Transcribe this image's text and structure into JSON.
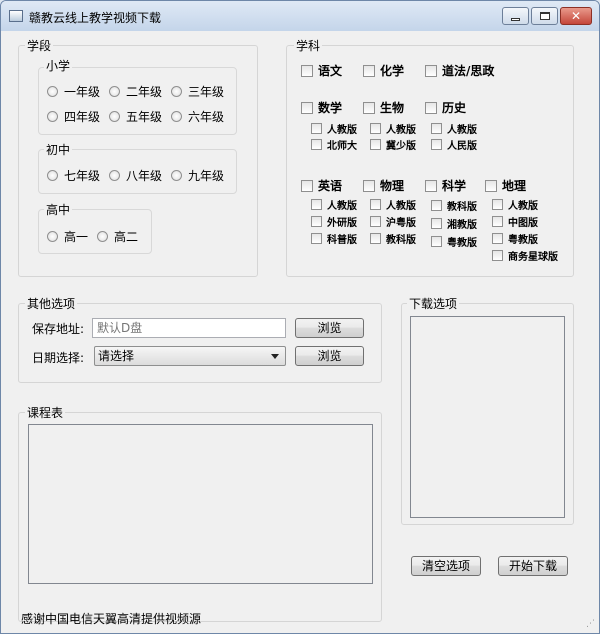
{
  "window": {
    "title": "赣教云线上教学视频下载"
  },
  "stage": {
    "title": "学段",
    "primary": {
      "title": "小学",
      "grades": [
        "一年级",
        "二年级",
        "三年级",
        "四年级",
        "五年级",
        "六年级"
      ]
    },
    "middle": {
      "title": "初中",
      "grades": [
        "七年级",
        "八年级",
        "九年级"
      ]
    },
    "high": {
      "title": "高中",
      "grades": [
        "高一",
        "高二"
      ]
    }
  },
  "subjects": {
    "title": "学科",
    "chinese": "语文",
    "chemistry": "化学",
    "morality": "道法/思政",
    "math": {
      "label": "数学",
      "versions": [
        "人教版",
        "北师大"
      ]
    },
    "biology": {
      "label": "生物",
      "versions": [
        "人教版",
        "冀少版"
      ]
    },
    "history": {
      "label": "历史",
      "versions": [
        "人教版",
        "人民版"
      ]
    },
    "english": {
      "label": "英语",
      "versions": [
        "人教版",
        "外研版",
        "科普版"
      ]
    },
    "physics": {
      "label": "物理",
      "versions": [
        "人教版",
        "沪粤版",
        "教科版"
      ]
    },
    "science": {
      "label": "科学",
      "versions": [
        "教科版",
        "湘教版",
        "粤教版"
      ]
    },
    "geography": {
      "label": "地理",
      "versions": [
        "人教版",
        "中图版",
        "粤教版",
        "商务星球版"
      ]
    }
  },
  "other": {
    "title": "其他选项",
    "save_label": "保存地址:",
    "save_placeholder": "默认D盘",
    "date_label": "日期选择:",
    "date_value": "请选择",
    "browse1": "浏览",
    "browse2": "浏览"
  },
  "schedule": {
    "title": "课程表"
  },
  "download": {
    "title": "下载选项",
    "clear": "清空选项",
    "start": "开始下载"
  },
  "footer": {
    "text": "感谢中国电信天翼高清提供视频源"
  }
}
